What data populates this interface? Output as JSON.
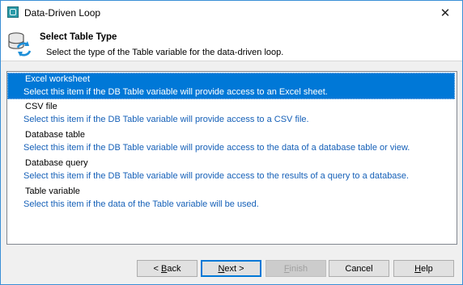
{
  "window": {
    "title": "Data-Driven Loop",
    "close_glyph": "✕"
  },
  "header": {
    "title": "Select Table Type",
    "subtitle": "Select the type of the Table variable for the data-driven loop."
  },
  "list": {
    "selected_index": 0,
    "items": [
      {
        "title": "Excel worksheet",
        "description": "Select this item if the DB Table variable will provide access to an Excel sheet."
      },
      {
        "title": "CSV file",
        "description": "Select this item if the DB Table variable will provide access to a CSV file."
      },
      {
        "title": "Database table",
        "description": "Select this item if the DB Table variable will provide access to the data of a database table or view."
      },
      {
        "title": "Database query",
        "description": "Select this item if the DB Table variable will provide access to the results of a query to a database."
      },
      {
        "title": "Table variable",
        "description": "Select this item if the data of the Table variable will be used."
      }
    ]
  },
  "buttons": {
    "back": {
      "prefix": "< ",
      "mnemonic": "B",
      "rest": "ack"
    },
    "next": {
      "mnemonic": "N",
      "rest": "ext >"
    },
    "finish": {
      "mnemonic": "F",
      "rest": "inish",
      "disabled": true
    },
    "cancel": "Cancel",
    "help": {
      "mnemonic": "H",
      "rest": "elp"
    }
  },
  "colors": {
    "selection": "#0078d7",
    "description_text": "#1560b8",
    "window_border": "#3a8fd6",
    "dialog_bg": "#f0f0f0"
  },
  "icons": {
    "app": "data-driven-loop-icon",
    "header": "database-refresh-icon",
    "close": "close-icon"
  }
}
